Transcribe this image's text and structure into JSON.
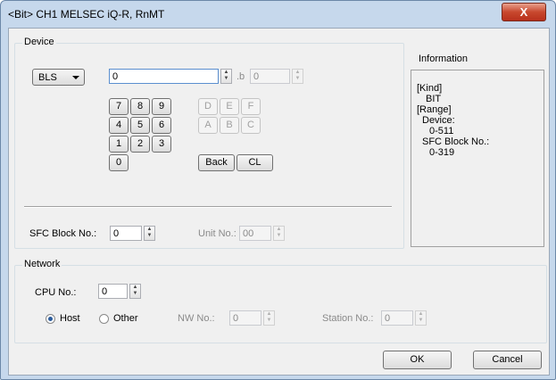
{
  "window": {
    "title": "<Bit> CH1 MELSEC iQ-R, RnMT",
    "close_glyph": "X"
  },
  "device": {
    "group_label": "Device",
    "type_value": "BLS",
    "address_value": "0",
    "bit_separator": ".b",
    "bit_value": "0",
    "keypad": {
      "row1": [
        "7",
        "8",
        "9",
        "D",
        "E",
        "F"
      ],
      "row2": [
        "4",
        "5",
        "6",
        "A",
        "B",
        "C"
      ],
      "row3": [
        "1",
        "2",
        "3"
      ],
      "row4": [
        "0"
      ],
      "back": "Back",
      "clear": "CL"
    },
    "sfc_block_label": "SFC Block No.:",
    "sfc_block_value": "0",
    "unit_label": "Unit No.:",
    "unit_value": "00"
  },
  "information": {
    "title": "Information",
    "lines": [
      "[Kind]",
      "BIT",
      "[Range]",
      "Device:",
      "0-511",
      "SFC Block No.:",
      "0-319"
    ]
  },
  "network": {
    "group_label": "Network",
    "cpu_label": "CPU No.:",
    "cpu_value": "0",
    "host_label": "Host",
    "other_label": "Other",
    "selected": "Host",
    "nw_label": "NW No.:",
    "nw_value": "0",
    "station_label": "Station No.:",
    "station_value": "0"
  },
  "buttons": {
    "ok": "OK",
    "cancel": "Cancel"
  }
}
